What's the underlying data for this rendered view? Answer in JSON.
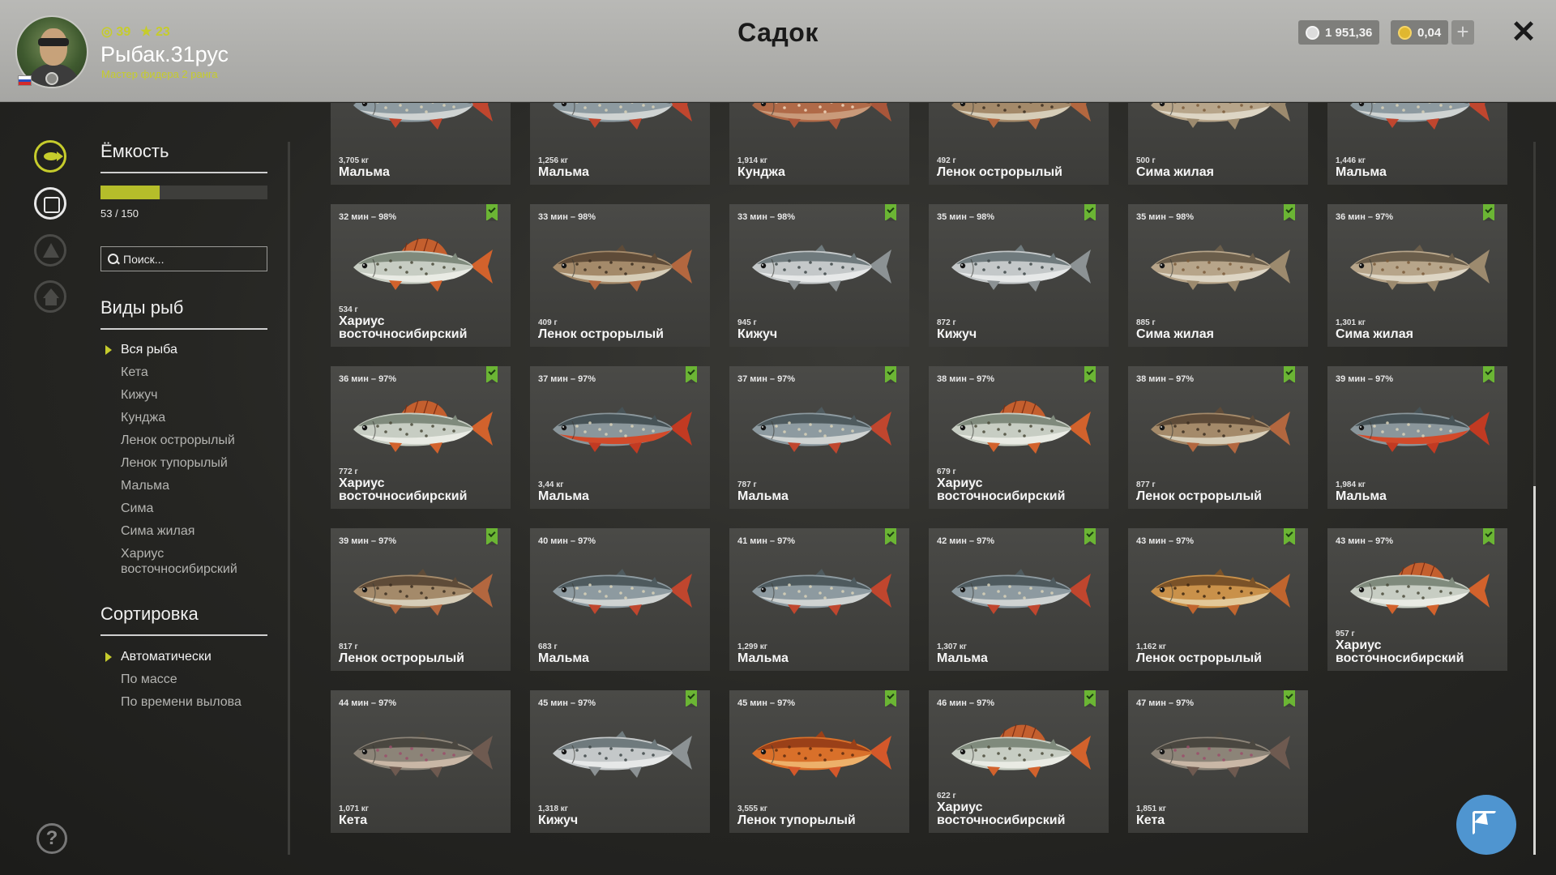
{
  "header": {
    "title": "Садок",
    "player_name": "Рыбак.31рус",
    "player_rank": "Мастер фидера 2 ранга",
    "level": "39",
    "stars": "23",
    "silver": "1 951,36",
    "gold": "0,04",
    "plus": "+",
    "close": "✕"
  },
  "sidebar": {
    "capacity_title": "Ёмкость",
    "capacity_text": "53 / 150",
    "capacity_fraction": 0.353,
    "search_placeholder": "Поиск...",
    "species_title": "Виды рыб",
    "species": [
      "Вся рыба",
      "Кета",
      "Кижуч",
      "Кунджа",
      "Ленок острорылый",
      "Ленок тупорылый",
      "Мальма",
      "Сима",
      "Сима жилая",
      "Хариус восточносибирский"
    ],
    "species_active": 0,
    "sort_title": "Сортировка",
    "sort": [
      "Автоматически",
      "По массе",
      "По времени вылова"
    ],
    "sort_active": 0,
    "help": "?"
  },
  "colors": {
    "accent": "#c6cc2c",
    "bookmark": "#6bb534",
    "cursor_button": "#4f95d0"
  },
  "cards": [
    {
      "time": "",
      "bookmark": false,
      "weight": "3,705 кг",
      "name": "Мальма",
      "fish": "malma"
    },
    {
      "time": "",
      "bookmark": false,
      "weight": "1,256 кг",
      "name": "Мальма",
      "fish": "malma"
    },
    {
      "time": "",
      "bookmark": false,
      "weight": "1,914 кг",
      "name": "Кунджа",
      "fish": "kundzha"
    },
    {
      "time": "",
      "bookmark": false,
      "weight": "492 г",
      "name": "Ленок острорылый",
      "fish": "lenok"
    },
    {
      "time": "",
      "bookmark": false,
      "weight": "500 г",
      "name": "Сима жилая",
      "fish": "sima"
    },
    {
      "time": "",
      "bookmark": false,
      "weight": "1,446 кг",
      "name": "Мальма",
      "fish": "malma"
    },
    {
      "time": "32 мин – 98%",
      "bookmark": true,
      "weight": "534 г",
      "name": "Хариус восточносибирский",
      "fish": "kharius"
    },
    {
      "time": "33 мин – 98%",
      "bookmark": false,
      "weight": "409 г",
      "name": "Ленок острорылый",
      "fish": "lenok"
    },
    {
      "time": "33 мин – 98%",
      "bookmark": true,
      "weight": "945 г",
      "name": "Кижуч",
      "fish": "kizhuch"
    },
    {
      "time": "35 мин – 98%",
      "bookmark": true,
      "weight": "872 г",
      "name": "Кижуч",
      "fish": "kizhuch"
    },
    {
      "time": "35 мин – 98%",
      "bookmark": true,
      "weight": "885 г",
      "name": "Сима жилая",
      "fish": "sima"
    },
    {
      "time": "36 мин – 97%",
      "bookmark": true,
      "weight": "1,301 кг",
      "name": "Сима жилая",
      "fish": "sima"
    },
    {
      "time": "36 мин – 97%",
      "bookmark": true,
      "weight": "772 г",
      "name": "Хариус восточносибирский",
      "fish": "kharius"
    },
    {
      "time": "37 мин – 97%",
      "bookmark": true,
      "weight": "3,44 кг",
      "name": "Мальма",
      "fish": "malma-red"
    },
    {
      "time": "37 мин – 97%",
      "bookmark": true,
      "weight": "787 г",
      "name": "Мальма",
      "fish": "malma"
    },
    {
      "time": "38 мин – 97%",
      "bookmark": true,
      "weight": "679 г",
      "name": "Хариус восточносибирский",
      "fish": "kharius"
    },
    {
      "time": "38 мин – 97%",
      "bookmark": true,
      "weight": "877 г",
      "name": "Ленок острорылый",
      "fish": "lenok"
    },
    {
      "time": "39 мин – 97%",
      "bookmark": true,
      "weight": "1,984 кг",
      "name": "Мальма",
      "fish": "malma-red"
    },
    {
      "time": "39 мин – 97%",
      "bookmark": true,
      "weight": "817 г",
      "name": "Ленок острорылый",
      "fish": "lenok"
    },
    {
      "time": "40 мин – 97%",
      "bookmark": false,
      "weight": "683 г",
      "name": "Мальма",
      "fish": "malma"
    },
    {
      "time": "41 мин – 97%",
      "bookmark": true,
      "weight": "1,299 кг",
      "name": "Мальма",
      "fish": "malma"
    },
    {
      "time": "42 мин – 97%",
      "bookmark": true,
      "weight": "1,307 кг",
      "name": "Мальма",
      "fish": "malma"
    },
    {
      "time": "43 мин – 97%",
      "bookmark": true,
      "weight": "1,162 кг",
      "name": "Ленок острорылый",
      "fish": "lenok-gold"
    },
    {
      "time": "43 мин – 97%",
      "bookmark": true,
      "weight": "957 г",
      "name": "Хариус восточносибирский",
      "fish": "kharius"
    },
    {
      "time": "44 мин – 97%",
      "bookmark": false,
      "weight": "1,071 кг",
      "name": "Кета",
      "fish": "keta"
    },
    {
      "time": "45 мин – 97%",
      "bookmark": true,
      "weight": "1,318 кг",
      "name": "Кижуч",
      "fish": "kizhuch"
    },
    {
      "time": "45 мин – 97%",
      "bookmark": true,
      "weight": "3,555 кг",
      "name": "Ленок тупорылый",
      "fish": "lenok-orange"
    },
    {
      "time": "46 мин – 97%",
      "bookmark": true,
      "weight": "622 г",
      "name": "Хариус восточносибирский",
      "fish": "kharius"
    },
    {
      "time": "47 мин – 97%",
      "bookmark": true,
      "weight": "1,851 кг",
      "name": "Кета",
      "fish": "keta"
    }
  ]
}
